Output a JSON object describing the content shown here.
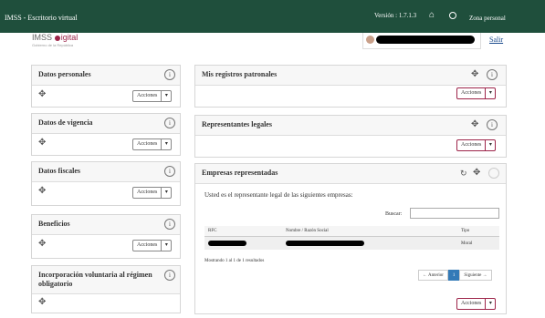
{
  "topbar": {
    "title": "IMSS - Escritorio virtual",
    "version": "Versión : 1.7.1.3",
    "home_icon": "home-icon",
    "status_icon": "gauge-icon",
    "zona_label": "Zona personal"
  },
  "logo": {
    "imss": "IMSS",
    "digital": "igital",
    "tagline": "Gobierno de la República"
  },
  "user": {
    "salir": "Salir"
  },
  "left_cards": [
    {
      "title": "Datos personales",
      "actions": "Acciones"
    },
    {
      "title": "Datos de vigencia",
      "actions": "Acciones"
    },
    {
      "title": "Datos fiscales",
      "actions": "Acciones"
    },
    {
      "title": "Beneficios",
      "actions": "Acciones"
    },
    {
      "title": "Incorporación voluntaria al régimen obligatorio"
    }
  ],
  "right_cards": {
    "registros": {
      "title": "Mis registros patronales",
      "actions": "Acciones"
    },
    "representantes": {
      "title": "Representantes legales",
      "actions": "Acciones"
    },
    "empresas": {
      "title": "Empresas representadas",
      "intro": "Usted es el representante legal de las siguientes empresas:",
      "buscar": "Buscar:",
      "columns": [
        "RFC",
        "Nombre / Razón Social",
        "Tipo"
      ],
      "rows": [
        {
          "tipo": "Moral"
        }
      ],
      "mostrando": "Mostrando 1 al 1 de 1 resultados",
      "pager": {
        "prev": "← Anterior",
        "page": "1",
        "next": "Siguiente →"
      },
      "actions": "Acciones"
    }
  },
  "colors": {
    "topbar": "#1f4f3c",
    "accent": "#9d2449",
    "pager_active": "#337ab7"
  }
}
